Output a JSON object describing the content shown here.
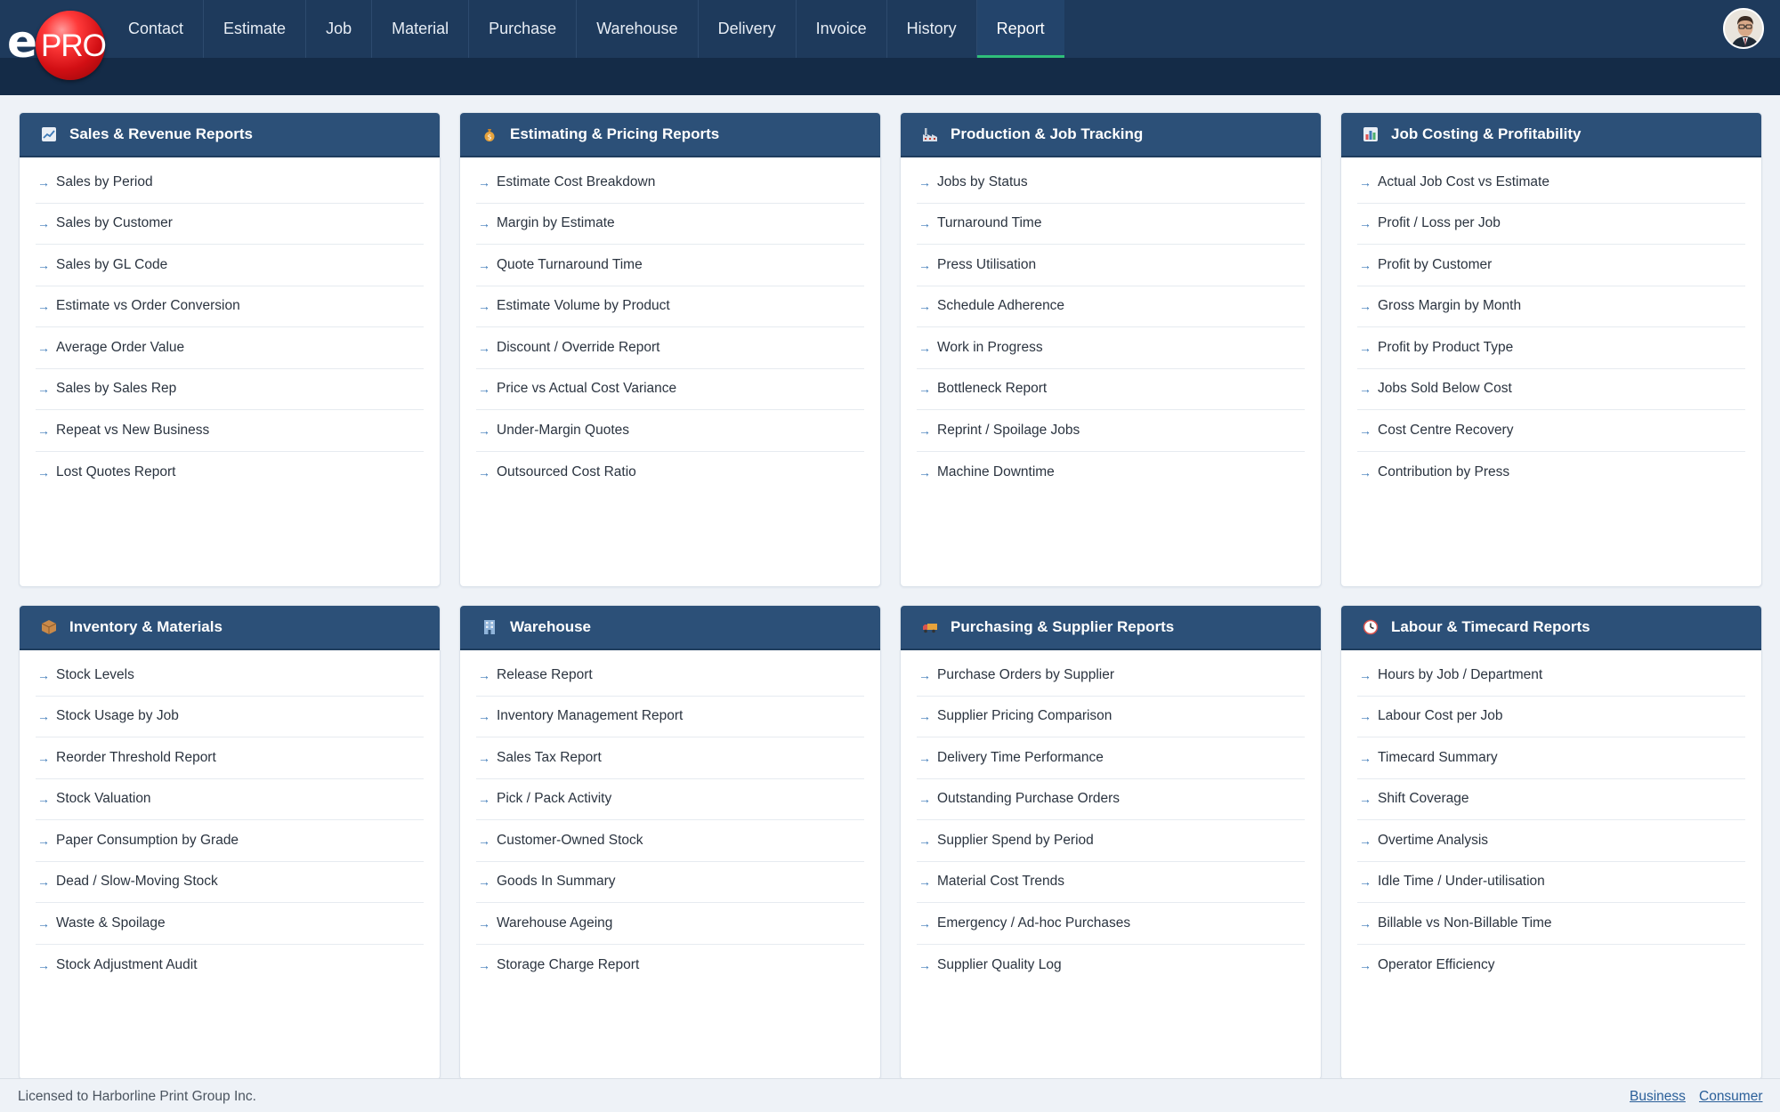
{
  "brand": {
    "logo_e": "e",
    "logo_pro": "PRO"
  },
  "nav": {
    "items": [
      "Contact",
      "Estimate",
      "Job",
      "Material",
      "Purchase",
      "Warehouse",
      "Delivery",
      "Invoice",
      "History",
      "Report"
    ],
    "active": "Report"
  },
  "cards": [
    {
      "title": "Sales & Revenue Reports",
      "icon": "chart-up-icon",
      "items": [
        "Sales by Period",
        "Sales by Customer",
        "Sales by GL Code",
        "Estimate vs Order Conversion",
        "Average Order Value",
        "Sales by Sales Rep",
        "Repeat vs New Business",
        "Lost Quotes Report"
      ]
    },
    {
      "title": "Estimating & Pricing Reports",
      "icon": "money-bag-icon",
      "items": [
        "Estimate Cost Breakdown",
        "Margin by Estimate",
        "Quote Turnaround Time",
        "Estimate Volume by Product",
        "Discount / Override Report",
        "Price vs Actual Cost Variance",
        "Under-Margin Quotes",
        "Outsourced Cost Ratio"
      ]
    },
    {
      "title": "Production & Job Tracking",
      "icon": "factory-icon",
      "items": [
        "Jobs by Status",
        "Turnaround Time",
        "Press Utilisation",
        "Schedule Adherence",
        "Work in Progress",
        "Bottleneck Report",
        "Reprint / Spoilage Jobs",
        "Machine Downtime"
      ]
    },
    {
      "title": "Job Costing & Profitability",
      "icon": "bar-chart-icon",
      "items": [
        "Actual Job Cost vs Estimate",
        "Profit / Loss per Job",
        "Profit by Customer",
        "Gross Margin by Month",
        "Profit by Product Type",
        "Jobs Sold Below Cost",
        "Cost Centre Recovery",
        "Contribution by Press"
      ]
    },
    {
      "title": "Inventory & Materials",
      "icon": "package-icon",
      "items": [
        "Stock Levels",
        "Stock Usage by Job",
        "Reorder Threshold Report",
        "Stock Valuation",
        "Paper Consumption by Grade",
        "Dead / Slow-Moving Stock",
        "Waste & Spoilage",
        "Stock Adjustment Audit"
      ]
    },
    {
      "title": "Warehouse",
      "icon": "building-icon",
      "items": [
        "Release Report",
        "Inventory Management Report",
        "Sales Tax Report",
        "Pick / Pack Activity",
        "Customer-Owned Stock",
        "Goods In Summary",
        "Warehouse Ageing",
        "Storage Charge Report"
      ]
    },
    {
      "title": "Purchasing & Supplier Reports",
      "icon": "truck-icon",
      "items": [
        "Purchase Orders by Supplier",
        "Supplier Pricing Comparison",
        "Delivery Time Performance",
        "Outstanding Purchase Orders",
        "Supplier Spend by Period",
        "Material Cost Trends",
        "Emergency / Ad-hoc Purchases",
        "Supplier Quality Log"
      ]
    },
    {
      "title": "Labour & Timecard Reports",
      "icon": "clock-icon",
      "items": [
        "Hours by Job / Department",
        "Labour Cost per Job",
        "Timecard Summary",
        "Shift Coverage",
        "Overtime Analysis",
        "Idle Time / Under-utilisation",
        "Billable vs Non-Billable Time",
        "Operator Efficiency"
      ]
    }
  ],
  "footer": {
    "license": "Licensed to Harborline Print Group Inc.",
    "links": [
      "Business",
      "Consumer"
    ]
  }
}
